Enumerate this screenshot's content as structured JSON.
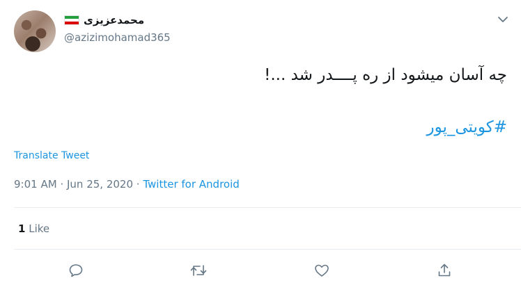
{
  "author": {
    "display_name": "محمدعزیزی",
    "handle": "@azizimohamad365",
    "flag_icon": "iran-flag-icon"
  },
  "tweet": {
    "text": "چه آسان میشود از ره پــــدر شد ...!",
    "hashtag": "#کویتی_پور",
    "translate_label": "Translate Tweet",
    "time": "9:01 AM",
    "separator": "·",
    "date": "Jun 25, 2020",
    "source": "Twitter for Android"
  },
  "stats": {
    "likes_count": "1",
    "likes_label": "Like"
  },
  "actions": {
    "icons": [
      "reply-icon",
      "retweet-icon",
      "like-icon",
      "share-icon"
    ]
  },
  "colors": {
    "link": "#1b95e0",
    "secondary_text": "#657786",
    "icon": "#657786",
    "divider": "#e6ecf0"
  }
}
